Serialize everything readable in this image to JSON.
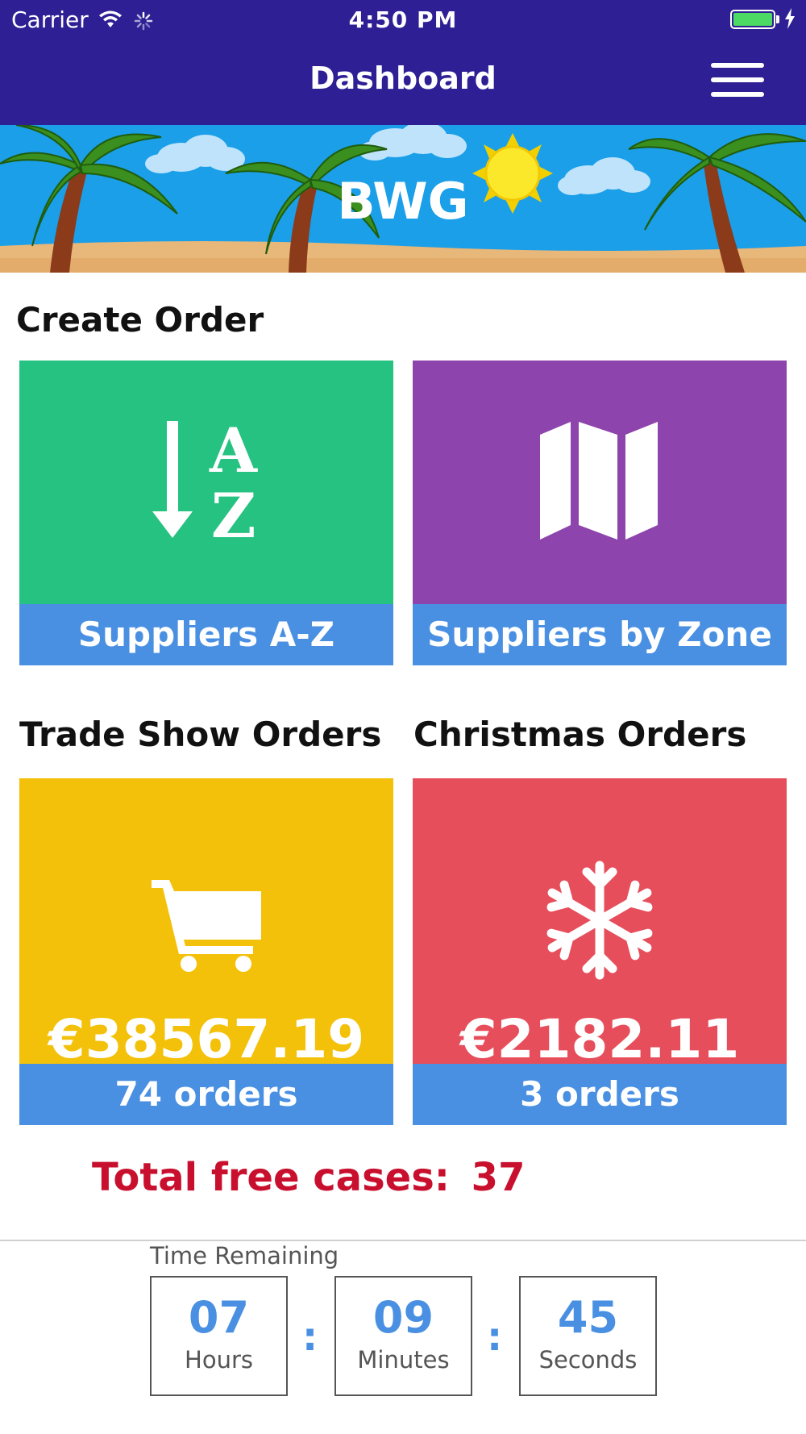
{
  "status_bar": {
    "carrier": "Carrier",
    "time": "4:50 PM"
  },
  "nav": {
    "title": "Dashboard",
    "menu_icon": "hamburger-menu-icon"
  },
  "banner": {
    "title": "BWG"
  },
  "sections": {
    "create_order": "Create Order",
    "trade_show": "Trade Show Orders",
    "christmas": "Christmas Orders"
  },
  "tiles": {
    "suppliers_az": {
      "label": "Suppliers A-Z",
      "icon": "sort-alpha-down-icon",
      "color": "#26c281",
      "icon_letter_a": "A",
      "icon_letter_z": "Z"
    },
    "suppliers_zone": {
      "label": "Suppliers by Zone",
      "icon": "map-icon",
      "color": "#8e44ad"
    },
    "trade_show": {
      "amount": "€38567.19",
      "count_label": "74 orders",
      "icon": "shopping-cart-icon",
      "color": "#f3c10a"
    },
    "christmas": {
      "amount": "€2182.11",
      "count_label": "3 orders",
      "icon": "snowflake-icon",
      "color": "#e74e5c"
    }
  },
  "totals": {
    "label": "Total free cases:",
    "value": "37"
  },
  "timer": {
    "label": "Time Remaining",
    "hours": "07",
    "hours_label": "Hours",
    "minutes": "09",
    "minutes_label": "Minutes",
    "seconds": "45",
    "seconds_label": "Seconds",
    "separator": ":"
  },
  "colors": {
    "nav_bg": "#2e1f95",
    "footer_blue": "#4a90e2",
    "totals_red": "#c8102e"
  }
}
